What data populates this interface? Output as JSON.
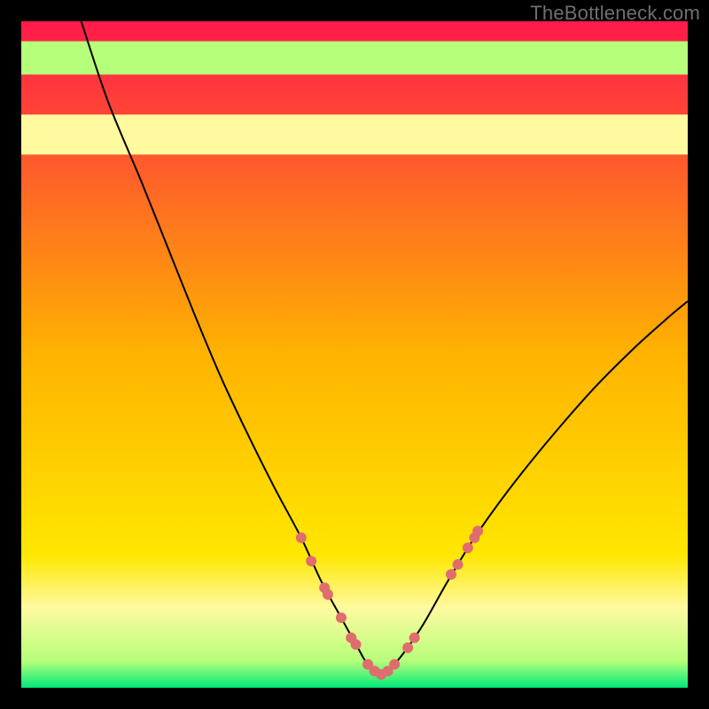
{
  "watermark": "TheBottleneck.com",
  "chart_data": {
    "type": "line",
    "title": "",
    "xlabel": "",
    "ylabel": "",
    "xlim": [
      0,
      100
    ],
    "ylim": [
      0,
      100
    ],
    "grid": false,
    "legend": false,
    "background_gradient": {
      "top_color": "#ff1a4b",
      "mid_color": "#ffd500",
      "bottom_color": "#00e97a",
      "stops": [
        {
          "offset": 0.0,
          "color": "#ff1a4b"
        },
        {
          "offset": 0.5,
          "color": "#ffb300"
        },
        {
          "offset": 0.8,
          "color": "#ffe700"
        },
        {
          "offset": 0.88,
          "color": "#fff9a0"
        },
        {
          "offset": 0.96,
          "color": "#b6ff7a"
        },
        {
          "offset": 1.0,
          "color": "#00e97a"
        }
      ]
    },
    "highlight_bands": [
      {
        "y0": 80,
        "y1": 86,
        "color": "#fff9a0"
      },
      {
        "y0": 92,
        "y1": 97,
        "color": "#b6ff7a"
      }
    ],
    "series": [
      {
        "name": "bottleneck-curve",
        "x": [
          9,
          13,
          18,
          22,
          26,
          30,
          34,
          38,
          42,
          45,
          48,
          50.5,
          52,
          54,
          56,
          60,
          64,
          68,
          73,
          79,
          86,
          92,
          97,
          100
        ],
        "values": [
          100,
          88,
          76,
          66,
          56,
          46.5,
          38,
          30,
          22.5,
          16,
          10.5,
          6,
          3.5,
          2,
          3.5,
          9,
          16,
          22.5,
          29.5,
          37,
          45,
          51,
          55.5,
          58
        ],
        "stroke": "#000000",
        "stroke_width": 2
      }
    ],
    "markers": {
      "name": "highlight-dots",
      "color": "#e06d6d",
      "radius_px": 6,
      "points": [
        {
          "x": 42.0,
          "y": 22.5
        },
        {
          "x": 43.5,
          "y": 19.0
        },
        {
          "x": 45.5,
          "y": 15.0
        },
        {
          "x": 46.0,
          "y": 14.0
        },
        {
          "x": 48.0,
          "y": 10.5
        },
        {
          "x": 49.5,
          "y": 7.5
        },
        {
          "x": 50.2,
          "y": 6.5
        },
        {
          "x": 52.0,
          "y": 3.5
        },
        {
          "x": 53.0,
          "y": 2.5
        },
        {
          "x": 54.0,
          "y": 2.0
        },
        {
          "x": 55.0,
          "y": 2.5
        },
        {
          "x": 56.0,
          "y": 3.5
        },
        {
          "x": 58.0,
          "y": 6.0
        },
        {
          "x": 59.0,
          "y": 7.5
        },
        {
          "x": 64.5,
          "y": 17.0
        },
        {
          "x": 65.5,
          "y": 18.5
        },
        {
          "x": 67.0,
          "y": 21.0
        },
        {
          "x": 68.0,
          "y": 22.5
        },
        {
          "x": 68.5,
          "y": 23.5
        }
      ]
    }
  }
}
